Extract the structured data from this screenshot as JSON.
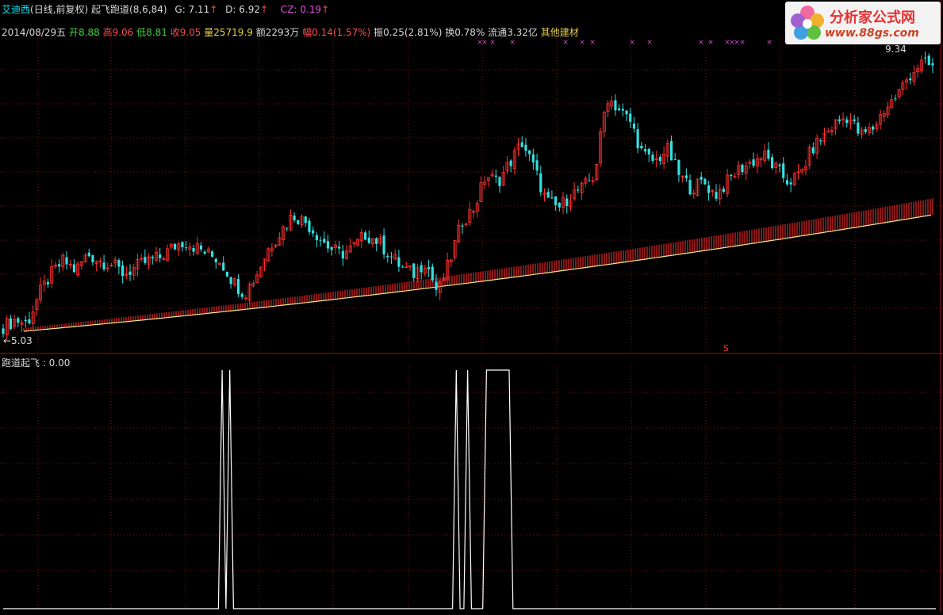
{
  "header": {
    "stock_name": "艾迪西",
    "period": "(日线,前复权)",
    "formula": "起飞跑道(8,6,84)",
    "g_label": "G: 7.11",
    "d_label": "D: 6.92",
    "cz_label": "CZ: 0.19",
    "arrow": "↑"
  },
  "quote": {
    "date": "2014/08/29五",
    "open_label": "开",
    "open": "8.88",
    "high_label": "高",
    "high": "9.06",
    "low_label": "低",
    "low": "8.81",
    "close_label": "收",
    "close": "9.05",
    "volume_label": "量",
    "volume": "25719.9",
    "amount_label": "额",
    "amount": "2293万",
    "change_label": "幅",
    "change": "0.14(1.57%)",
    "amplitude_label": "振",
    "amplitude": "0.25(2.81%)",
    "turnover_label": "换",
    "turnover": "0.78%",
    "float_label": "流通",
    "float_cap": "3.32亿",
    "other_link": "其他建材"
  },
  "logo": {
    "title": "分析家公式网",
    "url": "www.88gs.com"
  },
  "price_labels": {
    "low": "←5.03",
    "high": "9.34"
  },
  "signal_marker": "S",
  "indicator": {
    "label": "跑道起飞 : 0.00"
  },
  "colors": {
    "background": "#000000",
    "grid": "#7a1010",
    "up_candle": "#ff3030",
    "down_candle": "#33e0e0",
    "runway": "#c02020",
    "runway_line": "#f0e890",
    "signal_line": "#ffffff",
    "signal_cross": "#e040e0"
  },
  "chart_data": [
    {
      "type": "candlestick",
      "title": "艾迪西 (日线,前复权)",
      "ylim": [
        5.03,
        9.34
      ],
      "summary": {
        "low": 5.03,
        "high": 9.34,
        "last_close": 9.05,
        "g": 7.11,
        "d": 6.92,
        "cz": 0.19
      },
      "candles_close": [
        5.1,
        5.2,
        5.15,
        5.6,
        5.9,
        6.1,
        5.95,
        6.2,
        6.1,
        6.05,
        5.9,
        6.0,
        6.1,
        6.15,
        6.3,
        6.4,
        6.3,
        6.2,
        6.1,
        5.8,
        5.6,
        5.9,
        6.3,
        6.55,
        6.8,
        6.7,
        6.5,
        6.3,
        6.2,
        6.3,
        6.5,
        6.4,
        6.2,
        6.0,
        5.9,
        6.1,
        5.6,
        6.1,
        6.7,
        6.9,
        7.4,
        7.3,
        7.6,
        7.9,
        7.5,
        7.0,
        6.9,
        7.1,
        7.2,
        7.4,
        8.6,
        8.4,
        8.2,
        7.7,
        7.6,
        7.8,
        7.4,
        7.2,
        7.3,
        7.1,
        7.3,
        7.5,
        7.6,
        7.7,
        7.5,
        7.3,
        7.4,
        7.8,
        8.0,
        8.2,
        8.3,
        8.0,
        8.1,
        8.4,
        8.6,
        8.9,
        9.1,
        9.05
      ],
      "runway": {
        "start": 5.03,
        "end": 6.8
      }
    },
    {
      "type": "line",
      "title": "跑道起飞",
      "ylim": [
        0,
        1
      ],
      "series": [
        {
          "name": "跑道起飞",
          "values": [
            0,
            0,
            0,
            0,
            0,
            0,
            0,
            0,
            0,
            0,
            0,
            0,
            0,
            0,
            0,
            0,
            0,
            0,
            0,
            0,
            0,
            0,
            0,
            0,
            0,
            0,
            0,
            0,
            0,
            0,
            0,
            0,
            0,
            0,
            0,
            0,
            0,
            0,
            0,
            0,
            0,
            0,
            0,
            0,
            0,
            0,
            0,
            0,
            0,
            0,
            0,
            0,
            0,
            0,
            0,
            0,
            0,
            0,
            1,
            0,
            1,
            0,
            0,
            0,
            0,
            0,
            0,
            0,
            0,
            0,
            0,
            0,
            0,
            0,
            0,
            0,
            0,
            0,
            0,
            0,
            0,
            0,
            0,
            0,
            0,
            0,
            0,
            0,
            0,
            0,
            0,
            0,
            0,
            0,
            0,
            0,
            0,
            0,
            0,
            0,
            0,
            0,
            0,
            0,
            0,
            0,
            0,
            0,
            0,
            0,
            0,
            0,
            0,
            0,
            0,
            0,
            0,
            0,
            0,
            0,
            1,
            0,
            0,
            1,
            0,
            0,
            0,
            0,
            1,
            1,
            1,
            1,
            1,
            1,
            1,
            0,
            0,
            0,
            0,
            0,
            0,
            0,
            0,
            0,
            0,
            0,
            0,
            0,
            0,
            0,
            0,
            0,
            0,
            0,
            0,
            0,
            0,
            0,
            0,
            0,
            0,
            0,
            0,
            0,
            0,
            0,
            0,
            0,
            0,
            0,
            0,
            0,
            0,
            0,
            0,
            0,
            0,
            0,
            0,
            0,
            0,
            0,
            0,
            0,
            0,
            0,
            0,
            0,
            0,
            0,
            0,
            0,
            0,
            0,
            0,
            0,
            0,
            0,
            0,
            0,
            0,
            0,
            0,
            0,
            0,
            0,
            0,
            0,
            0,
            0,
            0,
            0,
            0,
            0,
            0,
            0,
            0,
            0,
            0,
            0,
            0,
            0,
            0,
            0,
            0,
            0,
            0,
            0,
            0,
            0,
            0,
            0,
            0,
            0,
            0,
            0,
            0,
            0,
            0,
            0,
            0,
            0,
            0,
            0,
            0,
            0,
            0,
            0
          ]
        }
      ]
    }
  ]
}
